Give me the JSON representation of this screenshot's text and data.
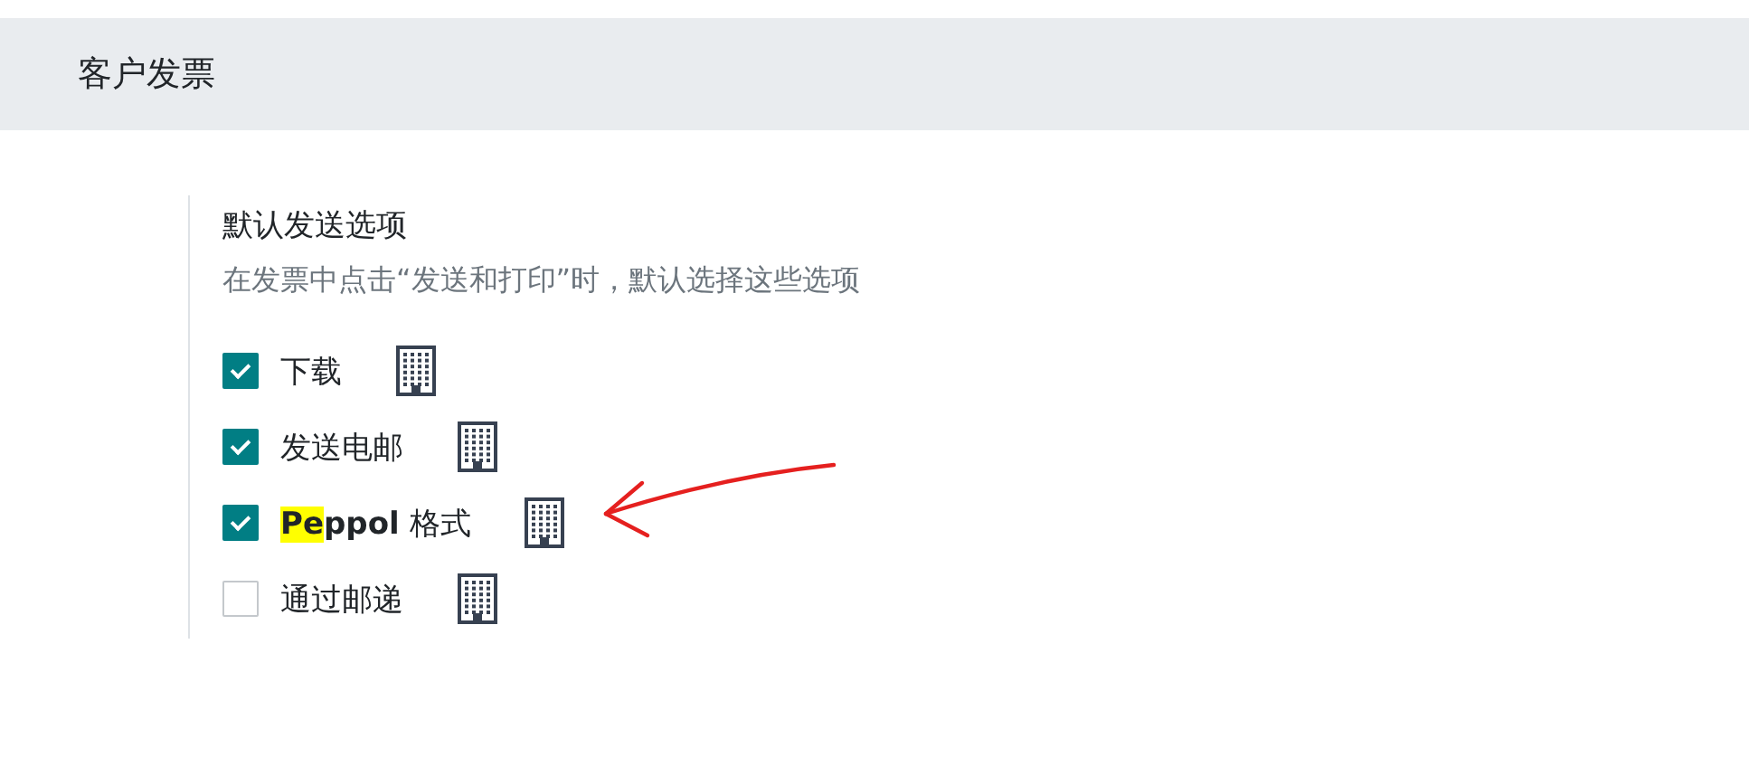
{
  "section": {
    "title": "客户发票"
  },
  "setting": {
    "title": "默认发送选项",
    "description": "在发票中点击“发送和打印”时，默认选择这些选项"
  },
  "options": [
    {
      "label_parts": [
        {
          "text": "下载",
          "highlighted": false,
          "bold": false
        }
      ],
      "checked": true
    },
    {
      "label_parts": [
        {
          "text": "发送电邮",
          "highlighted": false,
          "bold": false
        }
      ],
      "checked": true
    },
    {
      "label_parts": [
        {
          "text": "Pe",
          "highlighted": true,
          "bold": true
        },
        {
          "text": "ppol",
          "highlighted": false,
          "bold": true
        },
        {
          "text": " 格式",
          "highlighted": false,
          "bold": false
        }
      ],
      "checked": true
    },
    {
      "label_parts": [
        {
          "text": "通过邮递",
          "highlighted": false,
          "bold": false
        }
      ],
      "checked": false
    }
  ],
  "annotation": {
    "kind": "arrow",
    "color": "#e5201f"
  }
}
